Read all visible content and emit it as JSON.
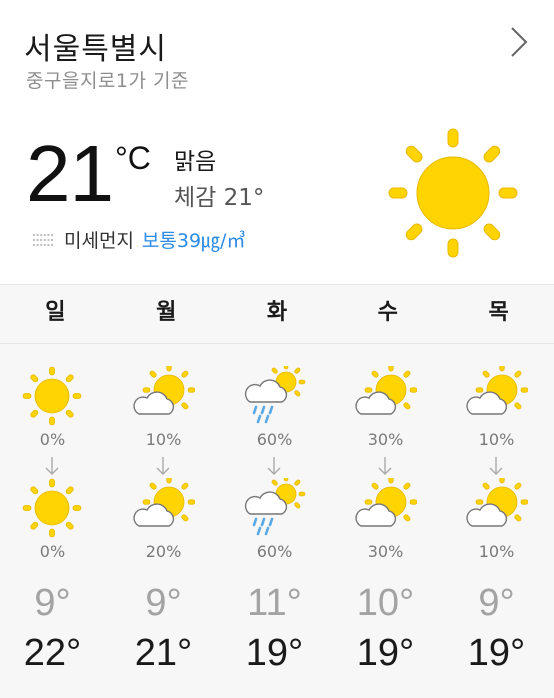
{
  "location": {
    "city": "서울특별시",
    "basis": "중구을지로1가 기준"
  },
  "current": {
    "temp": "21",
    "unit": "°C",
    "condition": "맑음",
    "feels_like": "체감 21°",
    "dust_label": "미세먼지",
    "dust_value": "보통39㎍/㎥",
    "icon": "sun-icon"
  },
  "days": [
    "일",
    "월",
    "화",
    "수",
    "목"
  ],
  "forecast": [
    {
      "am_icon": "sun-icon",
      "am_pct": "0%",
      "pm_icon": "sun-icon",
      "pm_pct": "0%",
      "low": "9°",
      "high": "22°"
    },
    {
      "am_icon": "partly-cloudy-icon",
      "am_pct": "10%",
      "pm_icon": "partly-cloudy-icon",
      "pm_pct": "20%",
      "low": "9°",
      "high": "21°"
    },
    {
      "am_icon": "rain-icon",
      "am_pct": "60%",
      "pm_icon": "rain-icon",
      "pm_pct": "60%",
      "low": "11°",
      "high": "19°"
    },
    {
      "am_icon": "partly-cloudy-icon",
      "am_pct": "30%",
      "pm_icon": "partly-cloudy-icon",
      "pm_pct": "30%",
      "low": "10°",
      "high": "19°"
    },
    {
      "am_icon": "partly-cloudy-icon",
      "am_pct": "10%",
      "pm_icon": "partly-cloudy-icon",
      "pm_pct": "10%",
      "low": "9°",
      "high": "19°"
    }
  ],
  "colors": {
    "sun": "#FFD400",
    "sun_stroke": "#E8B800",
    "dust_status": "#2b8be6",
    "rain": "#5aa9e6"
  }
}
